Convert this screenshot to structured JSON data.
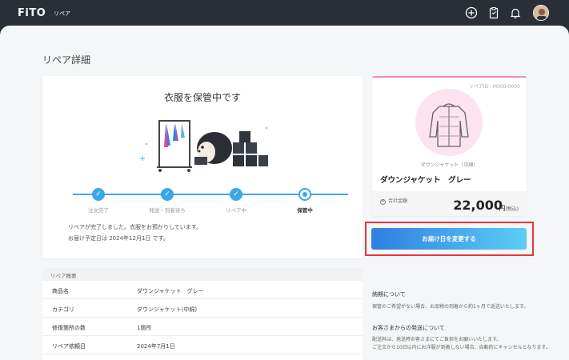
{
  "header": {
    "logo": "FiTO",
    "logo_sub": "リペア",
    "icons": [
      "add-circle-icon",
      "clipboard-icon",
      "bell-icon",
      "user-avatar"
    ]
  },
  "page": {
    "title": "リペア詳細"
  },
  "status": {
    "title": "衣服を保管中です",
    "steps": [
      {
        "label": "注文完了",
        "state": "done"
      },
      {
        "label": "発送・到着待ち",
        "state": "done"
      },
      {
        "label": "リペア中",
        "state": "done"
      },
      {
        "label": "保管中",
        "state": "current"
      }
    ],
    "message_line1": "リペアが完了しました。衣服をお預かりしています。",
    "message_line2": "お届け予定日は 2024年12月1日 です。"
  },
  "repair": {
    "id_label": "リペアID : M000-0000",
    "category": "ダウンジャケット（中綿）",
    "product_name": "ダウンジャケット　グレー",
    "total_label": "合計金額",
    "price": "22,000",
    "yen": "円",
    "tax": "(税込)"
  },
  "actions": {
    "change_delivery": "お届け日を変更する"
  },
  "summary": {
    "heading": "リペア概要",
    "rows": [
      {
        "key": "商品名",
        "value": "ダウンジャケット　グレー"
      },
      {
        "key": "カテゴリ",
        "value": "ダウンジャケット(中綿)"
      },
      {
        "key": "修復箇所の数",
        "value": "1箇所"
      },
      {
        "key": "リペア依頼日",
        "value": "2024年7月1日"
      }
    ]
  },
  "side": {
    "delivery_heading": "納期について",
    "delivery_text": "保管のご希望がない場合、お品物の到着から約1ヶ月で返送いたします。",
    "shipping_heading": "お客さまからの発送について",
    "shipping_text1": "配送料は、発送時お客さまにてご負担をお願いいたします。",
    "shipping_text2": "ご注文から10日以内にお洋服が到着しない場合、自動的にキャンセルとなります。"
  },
  "colors": {
    "accent": "#3aa8e6",
    "pink": "#f08bb0",
    "highlight": "#e5363f"
  }
}
